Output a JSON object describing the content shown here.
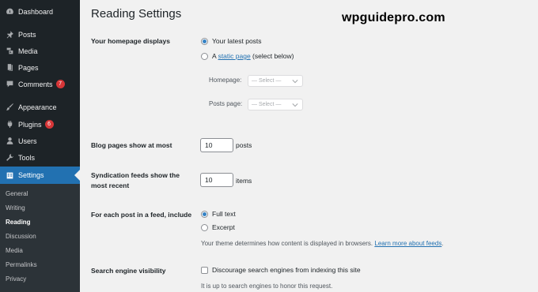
{
  "sidebar": {
    "items": [
      {
        "label": "Dashboard",
        "icon": "dashboard-icon"
      },
      {
        "label": "Posts",
        "icon": "pin-icon"
      },
      {
        "label": "Media",
        "icon": "media-icon"
      },
      {
        "label": "Pages",
        "icon": "page-icon"
      },
      {
        "label": "Comments",
        "icon": "comment-icon",
        "badge": "7"
      },
      {
        "label": "Appearance",
        "icon": "brush-icon"
      },
      {
        "label": "Plugins",
        "icon": "plug-icon",
        "badge": "6"
      },
      {
        "label": "Users",
        "icon": "user-icon"
      },
      {
        "label": "Tools",
        "icon": "wrench-icon"
      },
      {
        "label": "Settings",
        "icon": "settings-icon"
      }
    ],
    "submenu": [
      "General",
      "Writing",
      "Reading",
      "Discussion",
      "Media",
      "Permalinks",
      "Privacy"
    ],
    "current_submenu": "Reading"
  },
  "page": {
    "title": "Reading Settings",
    "brand": "wpguidepro.com"
  },
  "homepage": {
    "label": "Your homepage displays",
    "option_latest": "Your latest posts",
    "option_static_prefix": "A ",
    "option_static_link": "static page",
    "option_static_suffix": " (select below)",
    "selected": "latest",
    "homepage_label": "Homepage:",
    "homepage_value": "— Select —",
    "postspage_label": "Posts page:",
    "postspage_value": "— Select —"
  },
  "blog_pages": {
    "label": "Blog pages show at most",
    "value": "10",
    "suffix": "posts"
  },
  "syndication": {
    "label_line1": "Syndication feeds show the",
    "label_line2": "most recent",
    "value": "10",
    "suffix": "items"
  },
  "feed": {
    "label": "For each post in a feed, include",
    "option_full": "Full text",
    "option_excerpt": "Excerpt",
    "selected": "full",
    "desc_prefix": "Your theme determines how content is displayed in browsers. ",
    "desc_link": "Learn more about feeds",
    "desc_suffix": "."
  },
  "search_visibility": {
    "label": "Search engine visibility",
    "checkbox_label": "Discourage search engines from indexing this site",
    "checked": false,
    "desc": "It is up to search engines to honor this request."
  },
  "colors": {
    "sidebar_bg": "#1d2327",
    "submenu_bg": "#2c3338",
    "accent": "#2271b1",
    "badge": "#d63638",
    "page_bg": "#f1f1f1"
  }
}
